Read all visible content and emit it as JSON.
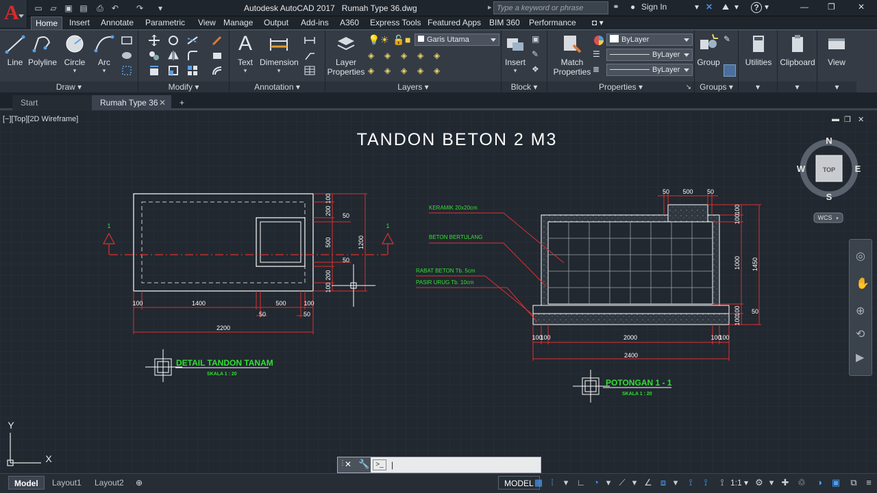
{
  "app": {
    "title": "Autodesk AutoCAD 2017",
    "file": "Rumah Type 36.dwg",
    "logo_letter": "A",
    "search_placeholder": "Type a keyword or phrase",
    "sign_in": "Sign In",
    "help": "?"
  },
  "menu_tabs": [
    "Home",
    "Insert",
    "Annotate",
    "Parametric",
    "View",
    "Manage",
    "Output",
    "Add-ins",
    "A360",
    "Express Tools",
    "Featured Apps",
    "BIM 360",
    "Performance"
  ],
  "ribbon": {
    "draw": {
      "title": "Draw",
      "buttons": [
        "Line",
        "Polyline",
        "Circle",
        "Arc"
      ]
    },
    "modify": {
      "title": "Modify"
    },
    "annotation": {
      "title": "Annotation",
      "buttons": [
        "Text",
        "Dimension"
      ]
    },
    "layers": {
      "title": "Layers",
      "button_line1": "Layer",
      "button_line2": "Properties",
      "current_layer": "Garis Utama"
    },
    "block": {
      "title": "Block",
      "button": "Insert"
    },
    "properties": {
      "title": "Properties",
      "button_line1": "Match",
      "button_line2": "Properties",
      "color": "ByLayer",
      "linetype": "ByLayer",
      "lineweight": "ByLayer"
    },
    "groups": {
      "title": "Groups",
      "button": "Group"
    },
    "utilities": {
      "button": "Utilities"
    },
    "clipboard": {
      "button": "Clipboard"
    },
    "view": {
      "button": "View"
    }
  },
  "file_tabs": [
    "Start",
    "Rumah Type 36"
  ],
  "viewport_label": "[−][Top][2D Wireframe]",
  "viewcube": {
    "top": "TOP",
    "n": "N",
    "s": "S",
    "e": "E",
    "w": "W",
    "wcs": "WCS"
  },
  "ucs": {
    "x": "X",
    "y": "Y"
  },
  "drawing": {
    "title": "TANDON BETON 2 M3",
    "plan": {
      "caption": "DETAIL TANDON TANAM",
      "scale": "SKALA 1 : 20",
      "section_mark": "1",
      "dims_bottom": [
        "100",
        "1400",
        "500",
        "100"
      ],
      "dims_bottom_sub": [
        "50",
        "50"
      ],
      "dim_total": "2200",
      "dims_right": [
        "200",
        "100",
        "50",
        "500",
        "50",
        "100",
        "200"
      ],
      "dim_right_total": "1200"
    },
    "section": {
      "caption": "POTONGAN 1 - 1",
      "scale": "SKALA 1 : 20",
      "labels": [
        "KERAMIK 20x20cm",
        "BETON BERTULANG",
        "RABAT BETON Tb. 5cm",
        "PASIR URUG Tb. 10cm"
      ],
      "dims_top": [
        "50",
        "500",
        "50"
      ],
      "dims_right": [
        "100",
        "100",
        "1000",
        "1450",
        "50",
        "100"
      ],
      "dims_bottom": [
        "100",
        "100",
        "2000",
        "100",
        "100"
      ],
      "dim_total": "2400"
    }
  },
  "command_line": {
    "prompt": "|"
  },
  "status": {
    "layout_tabs": [
      "Model",
      "Layout1",
      "Layout2"
    ],
    "model": "MODEL",
    "scale": "1:1"
  }
}
